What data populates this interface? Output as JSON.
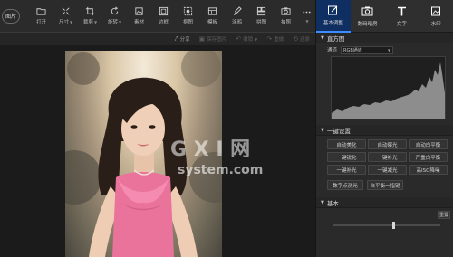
{
  "toolbar": {
    "open_label": "图片",
    "tools": [
      {
        "label": "打开",
        "icon": "folder-icon",
        "dd": false
      },
      {
        "label": "尺寸",
        "icon": "resize-icon",
        "dd": true
      },
      {
        "label": "裁剪",
        "icon": "crop-icon",
        "dd": true
      },
      {
        "label": "旋转",
        "icon": "rotate-icon",
        "dd": true
      },
      {
        "label": "素材",
        "icon": "sticker-icon",
        "dd": false
      },
      {
        "label": "边框",
        "icon": "frame-icon",
        "dd": false
      },
      {
        "label": "抠图",
        "icon": "cutout-icon",
        "dd": false
      },
      {
        "label": "模板",
        "icon": "template-icon",
        "dd": false
      },
      {
        "label": "涂鸦",
        "icon": "brush-icon",
        "dd": false
      },
      {
        "label": "拼图",
        "icon": "collage-icon",
        "dd": false
      },
      {
        "label": "拍照",
        "icon": "camera-icon",
        "dd": false
      },
      {
        "label": "",
        "icon": "more-icon",
        "dd": true
      }
    ]
  },
  "actionbar": {
    "share": "分享",
    "save": "保存图片",
    "undo": "撤销",
    "redo": "重做",
    "restore": "还原"
  },
  "panel": {
    "tabs": [
      {
        "label": "基本调整",
        "icon": "adjust-icon",
        "active": true
      },
      {
        "label": "数码暗房",
        "icon": "darkroom-icon",
        "active": false
      },
      {
        "label": "文字",
        "icon": "text-icon",
        "active": false
      },
      {
        "label": "水印",
        "icon": "watermark-icon",
        "active": false
      }
    ],
    "histogram_title": "直方图",
    "channel_label": "通道",
    "channel_value": "RGB通道",
    "quick_title": "一键设置",
    "quick_buttons": [
      "自动美化",
      "自动曝光",
      "自动白平衡",
      "一键锐化",
      "一键补光",
      "严重白平衡",
      "一键补光",
      "一键减光",
      "高ISO降噪"
    ],
    "extra_buttons": [
      "数字点测光",
      "白平衡一指键"
    ],
    "basic_title": "基本",
    "reset_label": "重置"
  },
  "watermark": "system.com",
  "colors": {
    "accent": "#3c8cff",
    "active_tab_bg": "#0f2f63",
    "panel_bg": "#2a2a2a",
    "canvas_bg": "#1b1b1b"
  }
}
